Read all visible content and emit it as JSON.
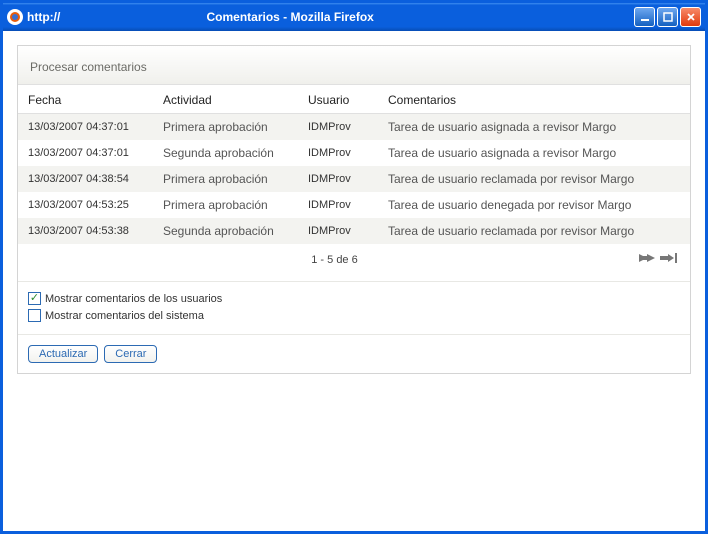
{
  "window": {
    "url": "http://",
    "title": "Comentarios - Mozilla Firefox"
  },
  "panel": {
    "title": "Procesar comentarios"
  },
  "columns": {
    "fecha": "Fecha",
    "actividad": "Actividad",
    "usuario": "Usuario",
    "comentarios": "Comentarios"
  },
  "rows": [
    {
      "fecha": "13/03/2007 04:37:01",
      "actividad": "Primera aprobación",
      "usuario": "IDMProv",
      "comentario": "Tarea de usuario asignada a revisor Margo"
    },
    {
      "fecha": "13/03/2007 04:37:01",
      "actividad": "Segunda aprobación",
      "usuario": "IDMProv",
      "comentario": "Tarea de usuario asignada a revisor Margo"
    },
    {
      "fecha": "13/03/2007 04:38:54",
      "actividad": "Primera aprobación",
      "usuario": "IDMProv",
      "comentario": "Tarea de usuario reclamada por revisor Margo"
    },
    {
      "fecha": "13/03/2007 04:53:25",
      "actividad": "Primera aprobación",
      "usuario": "IDMProv",
      "comentario": "Tarea de usuario denegada por revisor Margo"
    },
    {
      "fecha": "13/03/2007 04:53:38",
      "actividad": "Segunda aprobación",
      "usuario": "IDMProv",
      "comentario": "Tarea de usuario reclamada por revisor Margo"
    }
  ],
  "pager": {
    "text": "1 - 5 de 6"
  },
  "checks": {
    "user_comments": {
      "label": "Mostrar comentarios de los usuarios",
      "checked": true
    },
    "system_comments": {
      "label": "Mostrar comentarios del sistema",
      "checked": false
    }
  },
  "buttons": {
    "refresh": "Actualizar",
    "close": "Cerrar"
  }
}
